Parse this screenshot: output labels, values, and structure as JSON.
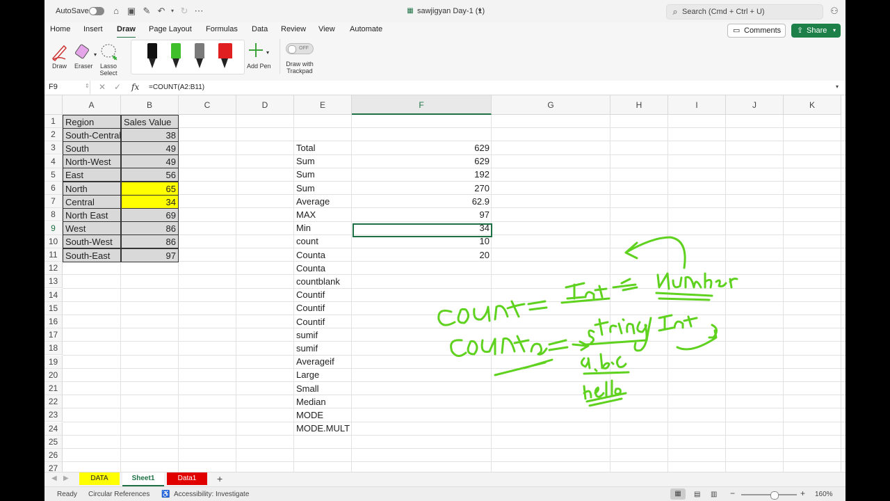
{
  "titlebar": {
    "autosave_label": "AutoSave",
    "doc_title": "sawjigyan Day-1 (1)",
    "search_placeholder": "Search (Cmd + Ctrl + U)"
  },
  "ribbon_tabs": [
    "Home",
    "Insert",
    "Draw",
    "Page Layout",
    "Formulas",
    "Data",
    "Review",
    "View",
    "Automate"
  ],
  "active_tab": "Draw",
  "actions": {
    "comments": "Comments",
    "share": "Share"
  },
  "draw_tools": {
    "draw": "Draw",
    "eraser": "Eraser",
    "lasso": "Lasso Select",
    "add_pen": "Add Pen",
    "trackpad": "Draw with Trackpad",
    "toggle_state": "OFF",
    "pen_colors": [
      "#111111",
      "#3fbf2a",
      "#7a7a7a",
      "#e02020"
    ]
  },
  "formula_bar": {
    "name_box": "F9",
    "fx": "fx",
    "formula": "=COUNT(A2:B11)"
  },
  "columns": [
    "A",
    "B",
    "C",
    "D",
    "E",
    "F",
    "G",
    "H",
    "I",
    "J",
    "K"
  ],
  "selected_column": "F",
  "selected_row": "9",
  "rows": [
    "1",
    "2",
    "3",
    "4",
    "5",
    "6",
    "7",
    "8",
    "9",
    "10",
    "11",
    "12",
    "13",
    "14",
    "15",
    "16",
    "17",
    "18",
    "19",
    "20",
    "21",
    "22",
    "23",
    "24",
    "25",
    "26",
    "27"
  ],
  "table": {
    "headers": [
      "Region",
      "Sales Value"
    ],
    "rows": [
      {
        "region": "South-Central",
        "value": "38"
      },
      {
        "region": "South",
        "value": "49"
      },
      {
        "region": "North-West",
        "value": "49"
      },
      {
        "region": "East",
        "value": "56"
      },
      {
        "region": "North",
        "value": "65",
        "highlight": "#ffff00"
      },
      {
        "region": "Central",
        "value": "34",
        "highlight": "#ffff00"
      },
      {
        "region": "North East",
        "value": "69"
      },
      {
        "region": "West",
        "value": "86"
      },
      {
        "region": "South-West",
        "value": "86"
      },
      {
        "region": "South-East",
        "value": "97"
      }
    ]
  },
  "functions": [
    {
      "label": "Total",
      "value": "629"
    },
    {
      "label": "Sum",
      "value": "629"
    },
    {
      "label": "Sum",
      "value": "192"
    },
    {
      "label": "Sum",
      "value": "270"
    },
    {
      "label": "Average",
      "value": "62.9"
    },
    {
      "label": "MAX",
      "value": "97"
    },
    {
      "label": "Min",
      "value": "34"
    },
    {
      "label": "count",
      "value": "10"
    },
    {
      "label": "Counta",
      "value": "20"
    },
    {
      "label": "Counta",
      "value": ""
    },
    {
      "label": "countblank",
      "value": ""
    },
    {
      "label": "Countif",
      "value": ""
    },
    {
      "label": "Countif",
      "value": ""
    },
    {
      "label": "Countif",
      "value": ""
    },
    {
      "label": "sumif",
      "value": ""
    },
    {
      "label": "sumif",
      "value": ""
    },
    {
      "label": "Averageif",
      "value": ""
    },
    {
      "label": "Large",
      "value": ""
    },
    {
      "label": "Small",
      "value": ""
    },
    {
      "label": "Median",
      "value": ""
    },
    {
      "label": "MODE",
      "value": ""
    },
    {
      "label": "MODE.MULT",
      "value": ""
    }
  ],
  "sheets": [
    {
      "name": "DATA",
      "bg": "#ffff00",
      "color": "#222222"
    },
    {
      "name": "Sheet1",
      "bg": "#ffffff",
      "color": "#1e7145",
      "active": true
    },
    {
      "name": "Data1",
      "bg": "#e00000",
      "color": "#ffffff"
    }
  ],
  "status": {
    "ready": "Ready",
    "circular": "Circular References",
    "accessibility": "Accessibility: Investigate",
    "zoom": "160%"
  },
  "ink_color": "#5fd11f"
}
